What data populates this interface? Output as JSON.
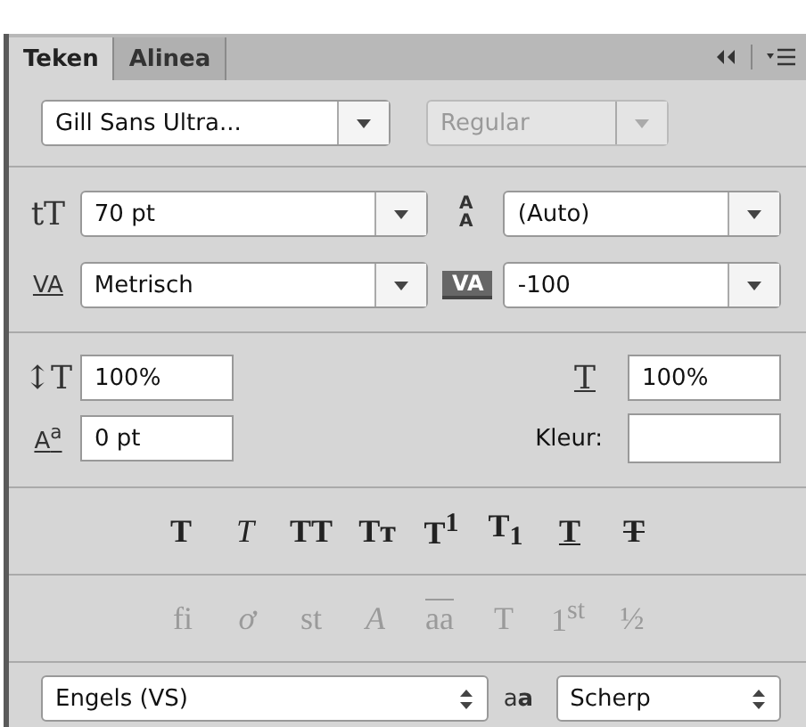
{
  "tabs": [
    {
      "label": "Teken",
      "selected": true
    },
    {
      "label": "Alinea",
      "selected": false
    }
  ],
  "font_family": {
    "value": "Gill Sans Ultra...",
    "disabled": false
  },
  "font_style": {
    "value": "Regular",
    "disabled": true
  },
  "size": {
    "icon": "tT",
    "value": "70 pt"
  },
  "leading": {
    "icon": "AA",
    "value": "(Auto)"
  },
  "kerning": {
    "icon": "VA",
    "value": "Metrisch"
  },
  "tracking": {
    "icon": "VA",
    "value": "-100"
  },
  "vertical_scale": {
    "icon": "↕T",
    "value": "100%"
  },
  "horizontal_scale": {
    "icon": "T",
    "value": "100%"
  },
  "baseline_shift": {
    "icon": "A$^{a}$",
    "value": "0 pt"
  },
  "color": {
    "label": "Kleur:"
  },
  "style_buttons": [
    {
      "glyph": "T",
      "kind": "bold",
      "disabled": false
    },
    {
      "glyph": "T",
      "kind": "italic",
      "disabled": false
    },
    {
      "glyph": "TT",
      "kind": "caps",
      "disabled": false
    },
    {
      "glyph": "Tт",
      "kind": "smallcaps",
      "disabled": false
    },
    {
      "glyph": "T$^{1}$",
      "kind": "super",
      "disabled": false
    },
    {
      "glyph": "T$_{1}$",
      "kind": "sub",
      "disabled": false
    },
    {
      "glyph": "T",
      "kind": "underline",
      "disabled": false
    },
    {
      "glyph": "T",
      "kind": "strike",
      "disabled": false
    }
  ],
  "opentype_buttons": [
    {
      "glyph": "fi",
      "kind": "plain",
      "disabled": true
    },
    {
      "glyph": "ơ",
      "kind": "italic",
      "disabled": true
    },
    {
      "glyph": "st",
      "kind": "plain",
      "disabled": true
    },
    {
      "glyph": "A",
      "kind": "italic",
      "disabled": true
    },
    {
      "glyph": "aa",
      "kind": "overline",
      "disabled": true
    },
    {
      "glyph": "T",
      "kind": "plain",
      "disabled": true
    },
    {
      "glyph": "1$^{st}$",
      "kind": "plain",
      "disabled": true
    },
    {
      "glyph": "½",
      "kind": "plain",
      "disabled": true
    }
  ],
  "language": {
    "value": "Engels (VS)"
  },
  "antialias": {
    "icon": "a**a**",
    "value": "Scherp"
  }
}
